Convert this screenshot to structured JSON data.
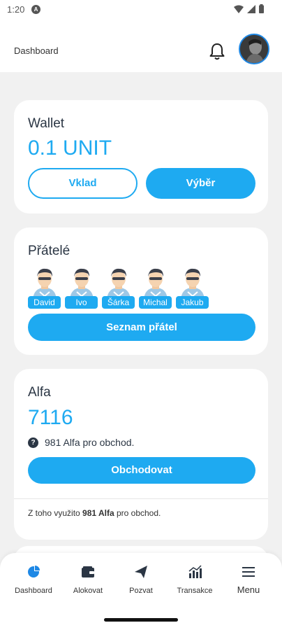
{
  "status": {
    "time": "1:20",
    "indicator": "A"
  },
  "header": {
    "title": "Dashboard",
    "bell_icon": "bell-icon",
    "avatar_icon": "user-avatar"
  },
  "wallet": {
    "title": "Wallet",
    "value": "0.1 UNIT",
    "deposit_label": "Vklad",
    "withdraw_label": "Výběr"
  },
  "friends": {
    "title": "Přátelé",
    "list": [
      "David",
      "Ivo",
      "Šárka",
      "Michal",
      "Jakub"
    ],
    "button_label": "Seznam přátel"
  },
  "alfa": {
    "title": "Alfa",
    "value": "7116",
    "info_text": "981 Alfa pro obchod.",
    "trade_label": "Obchodovat",
    "note_prefix": "Z toho využito ",
    "note_bold": "981 Alfa",
    "note_suffix": " pro obchod."
  },
  "nav": {
    "items": [
      {
        "label": "Dashboard",
        "icon": "pie-chart-icon"
      },
      {
        "label": "Alokovat",
        "icon": "wallet-icon"
      },
      {
        "label": "Pozvat",
        "icon": "paper-plane-icon"
      },
      {
        "label": "Transakce",
        "icon": "bar-chart-icon"
      },
      {
        "label": "Menu",
        "icon": "hamburger-icon"
      }
    ]
  },
  "colors": {
    "accent": "#1eaaf1",
    "text": "#2b3644",
    "background": "#f1f1f1"
  }
}
